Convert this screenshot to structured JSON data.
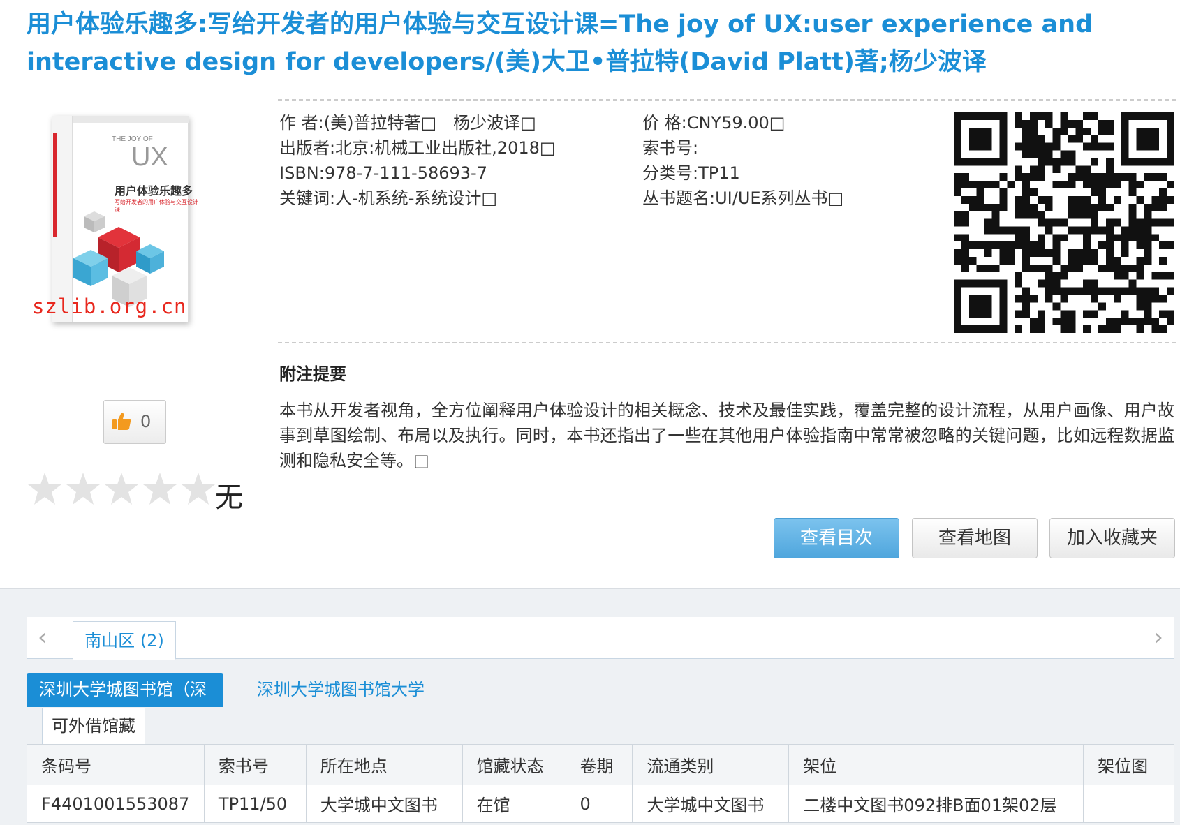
{
  "book": {
    "title": "用户体验乐趣多:写给开发者的用户体验与交互设计课=The joy of UX:user experience and interactive design for developers/(美)大卫•普拉特(David Platt)著;杨少波译",
    "cover": {
      "title_en_small": "THE JOY OF",
      "title_en_big": "UX",
      "title_cn": "用户体验乐趣多",
      "subtitle_cn": "写给开发者的用户体验与交互设计课",
      "watermark": "szlib.org.cn"
    },
    "like_count": "0",
    "rating": {
      "stars_filled": 0,
      "stars_total": 5,
      "text": "无"
    },
    "meta_left": [
      {
        "label": "作 者:",
        "value": "(美)普拉特著□　杨少波译□"
      },
      {
        "label": "出版者:",
        "value": "北京:机械工业出版社,2018□"
      },
      {
        "label": "ISBN:",
        "value": "978-7-111-58693-7"
      },
      {
        "label": "关键词:",
        "value": "人-机系统-系统设计□"
      }
    ],
    "meta_right": [
      {
        "label": "价 格:",
        "value": "CNY59.00□"
      },
      {
        "label": "索书号:",
        "value": ""
      },
      {
        "label": "分类号:",
        "value": "TP11"
      },
      {
        "label": "丛书题名:",
        "value": "UI/UE系列丛书□"
      }
    ],
    "note": {
      "title": "附注提要",
      "text": "本书从开发者视角，全方位阐释用户体验设计的相关概念、技术及最佳实践，覆盖完整的设计流程，从用户画像、用户故事到草图绘制、布局以及执行。同时，本书还指出了一些在其他用户体验指南中常常被忽略的关键问题，比如远程数据监测和隐私安全等。□"
    },
    "actions": {
      "toc": "查看目次",
      "map": "查看地图",
      "favorite": "加入收藏夹"
    }
  },
  "holdings": {
    "region_tab": "南山区 (2)",
    "library_tabs": [
      "深圳大学城图书馆（深",
      "深圳大学城图书馆大学"
    ],
    "subtab": "可外借馆藏",
    "columns": [
      "条码号",
      "索书号",
      "所在地点",
      "馆藏状态",
      "卷期",
      "流通类别",
      "架位",
      "架位图"
    ],
    "rows": [
      [
        "F4401001553087",
        "TP11/50",
        "大学城中文图书",
        "在馆",
        "0",
        "大学城中文图书",
        "二楼中文图书092排B面01架02层",
        ""
      ]
    ]
  },
  "colors": {
    "accent": "#1b8ed6",
    "watermark": "#e8281e",
    "button_primary": "#4fa6dd"
  }
}
